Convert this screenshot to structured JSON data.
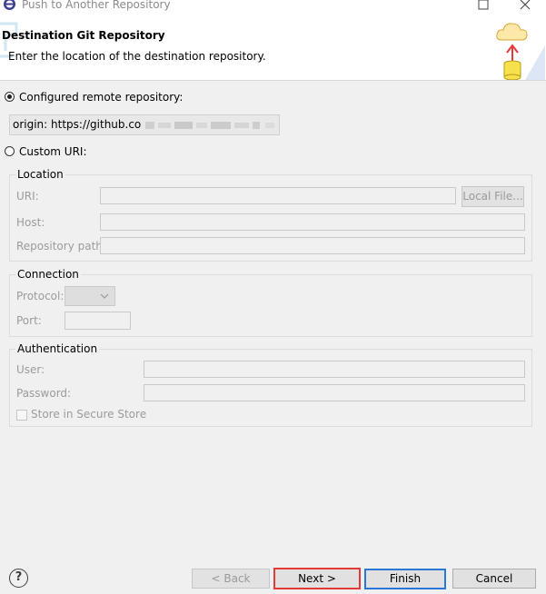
{
  "window": {
    "title": "Push to Another Repository"
  },
  "banner": {
    "title": "Destination Git Repository",
    "message": "Enter the location of the destination repository."
  },
  "source": {
    "configured_label": "Configured remote repository:",
    "configured_value": "origin: https://github.com",
    "custom_label": "Custom URI:",
    "selected": "configured"
  },
  "location": {
    "title": "Location",
    "uri_label": "URI:",
    "local_file_button": "Local File...",
    "host_label": "Host:",
    "repo_path_label": "Repository path:"
  },
  "connection": {
    "title": "Connection",
    "protocol_label": "Protocol:",
    "port_label": "Port:"
  },
  "authentication": {
    "title": "Authentication",
    "user_label": "User:",
    "password_label": "Password:",
    "store_label": "Store in Secure Store"
  },
  "buttons": {
    "help": "?",
    "back": "< Back",
    "next": "Next >",
    "finish": "Finish",
    "cancel": "Cancel"
  },
  "icons": {
    "app": "eclipse-icon",
    "maximize": "maximize-icon",
    "close": "close-icon",
    "wizard": "cloud-upload-repository-icon",
    "dropdown": "chevron-down-icon"
  },
  "colors": {
    "next_focus_border": "#e53935",
    "finish_default_border": "#2a78d6",
    "cloud_fill": "#fce8a8",
    "arrow_red": "#e53935",
    "cylinder_fill": "#f6e04c"
  }
}
